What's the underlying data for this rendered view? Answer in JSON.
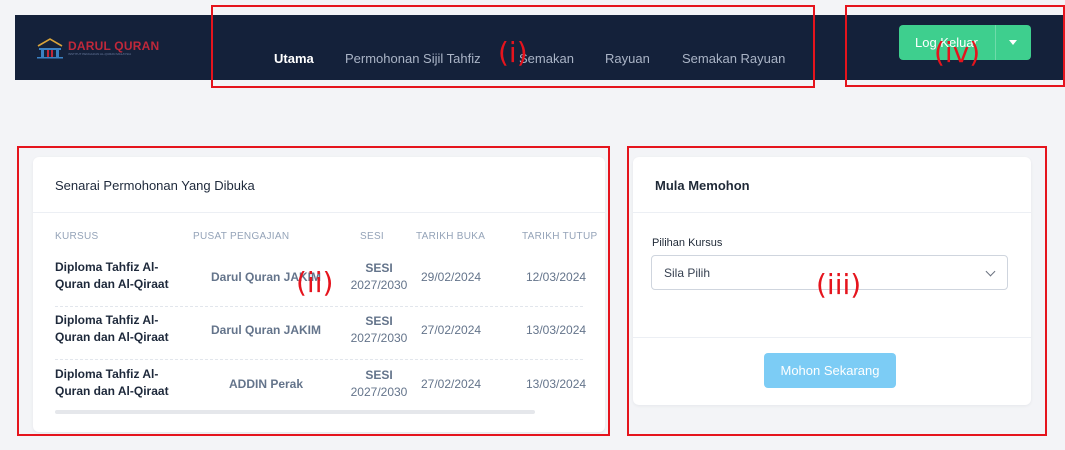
{
  "brand": {
    "name": "DARUL QURAN",
    "tagline": "INSTITUT PENGAJIAN AL-QURAN MALAYSIA",
    "color": "#c0283a"
  },
  "nav": {
    "items": [
      {
        "label": "Utama",
        "active": true
      },
      {
        "label": "Permohonan Sijil Tahfiz",
        "active": false
      },
      {
        "label": "Semakan",
        "active": false
      },
      {
        "label": "Rayuan",
        "active": false
      },
      {
        "label": "Semakan Rayuan",
        "active": false
      }
    ]
  },
  "account": {
    "logout_label": "Log Keluar",
    "button_color": "#3ecf8e"
  },
  "open_applications": {
    "title": "Senarai Permohonan Yang Dibuka",
    "columns": [
      "KURSUS",
      "PUSAT PENGAJIAN",
      "SESI",
      "TARIKH BUKA",
      "TARIKH TUTUP"
    ],
    "rows": [
      {
        "course": "Diploma Tahfiz Al-Quran dan Al-Qiraat",
        "center": "Darul Quran JAKIM",
        "session_label": "SESI",
        "session_years": "2027/2030",
        "open_date": "29/02/2024",
        "close_date": "12/03/2024"
      },
      {
        "course": "Diploma Tahfiz Al-Quran dan Al-Qiraat",
        "center": "Darul Quran JAKIM",
        "session_label": "SESI",
        "session_years": "2027/2030",
        "open_date": "27/02/2024",
        "close_date": "13/03/2024"
      },
      {
        "course": "Diploma Tahfiz Al-Quran dan Al-Qiraat",
        "center": "ADDIN Perak",
        "session_label": "SESI",
        "session_years": "2027/2030",
        "open_date": "27/02/2024",
        "close_date": "13/03/2024"
      }
    ]
  },
  "apply": {
    "title": "Mula Memohon",
    "field_label": "Pilihan Kursus",
    "select_value": "Sila Pilih",
    "submit_label": "Mohon Sekarang",
    "submit_color": "#7cccf5"
  },
  "annotations": [
    {
      "label": "(i)"
    },
    {
      "label": "(ii)"
    },
    {
      "label": "(iii)"
    },
    {
      "label": "(iv)"
    }
  ]
}
